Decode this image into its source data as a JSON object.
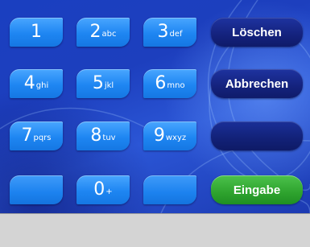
{
  "keypad": {
    "keys": {
      "k1": {
        "digit": "1",
        "letters": ""
      },
      "k2": {
        "digit": "2",
        "letters": "abc"
      },
      "k3": {
        "digit": "3",
        "letters": "def"
      },
      "k4": {
        "digit": "4",
        "letters": "ghi"
      },
      "k5": {
        "digit": "5",
        "letters": "jkl"
      },
      "k6": {
        "digit": "6",
        "letters": "mno"
      },
      "k7": {
        "digit": "7",
        "letters": "pqrs"
      },
      "k8": {
        "digit": "8",
        "letters": "tuv"
      },
      "k9": {
        "digit": "9",
        "letters": "wxyz"
      },
      "k0": {
        "digit": "0",
        "letters": "+"
      }
    },
    "delete_label": "Löschen",
    "cancel_label": "Abbrechen",
    "enter_label": "Eingabe"
  },
  "colors": {
    "background": "#1d3fbe",
    "digit_key": "#1e86f2",
    "function_key": "#14227d",
    "enter_key": "#2ea32e",
    "bottom_bar": "#d4d4d4"
  }
}
